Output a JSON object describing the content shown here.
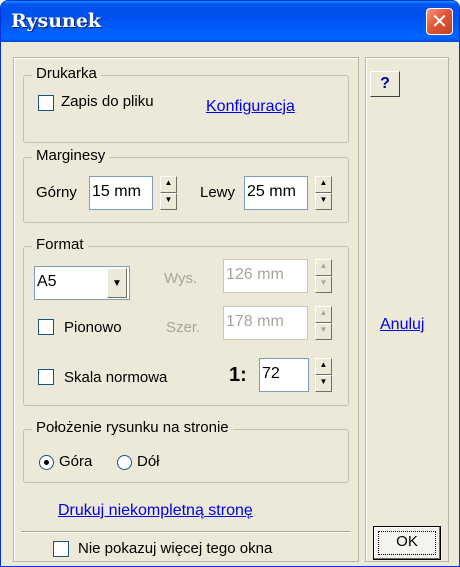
{
  "window": {
    "title": "Rysunek",
    "close_glyph": "✕"
  },
  "printer": {
    "legend": "Drukarka",
    "save_to_file_label": "Zapis do pliku",
    "save_to_file_checked": false,
    "config_link": "Konfiguracja"
  },
  "margins": {
    "legend": "Marginesy",
    "top_label": "Górny",
    "top_value": "15 mm",
    "left_label": "Lewy",
    "left_value": "25 mm"
  },
  "format": {
    "legend": "Format",
    "paper_selected": "A5",
    "height_label": "Wys.",
    "height_value": "126 mm",
    "width_label": "Szer.",
    "width_value": "178 mm",
    "portrait_label": "Pionowo",
    "portrait_checked": false,
    "scale_label": "Skala normowa",
    "scale_checked": false,
    "ratio_prefix": "1:",
    "ratio_value": "72"
  },
  "placement": {
    "legend": "Położenie rysunku na stronie",
    "top_label": "Góra",
    "bottom_label": "Dół",
    "selected": "Góra"
  },
  "print_incomplete_link": "Drukuj niekompletną stronę",
  "dont_show_label": "Nie pokazuj więcej tego okna",
  "buttons": {
    "help": "?",
    "cancel": "Anuluj",
    "ok": "OK"
  },
  "icons": {
    "close": "close-icon",
    "spin_up": "▲",
    "spin_down": "▼",
    "combo": "▼"
  }
}
